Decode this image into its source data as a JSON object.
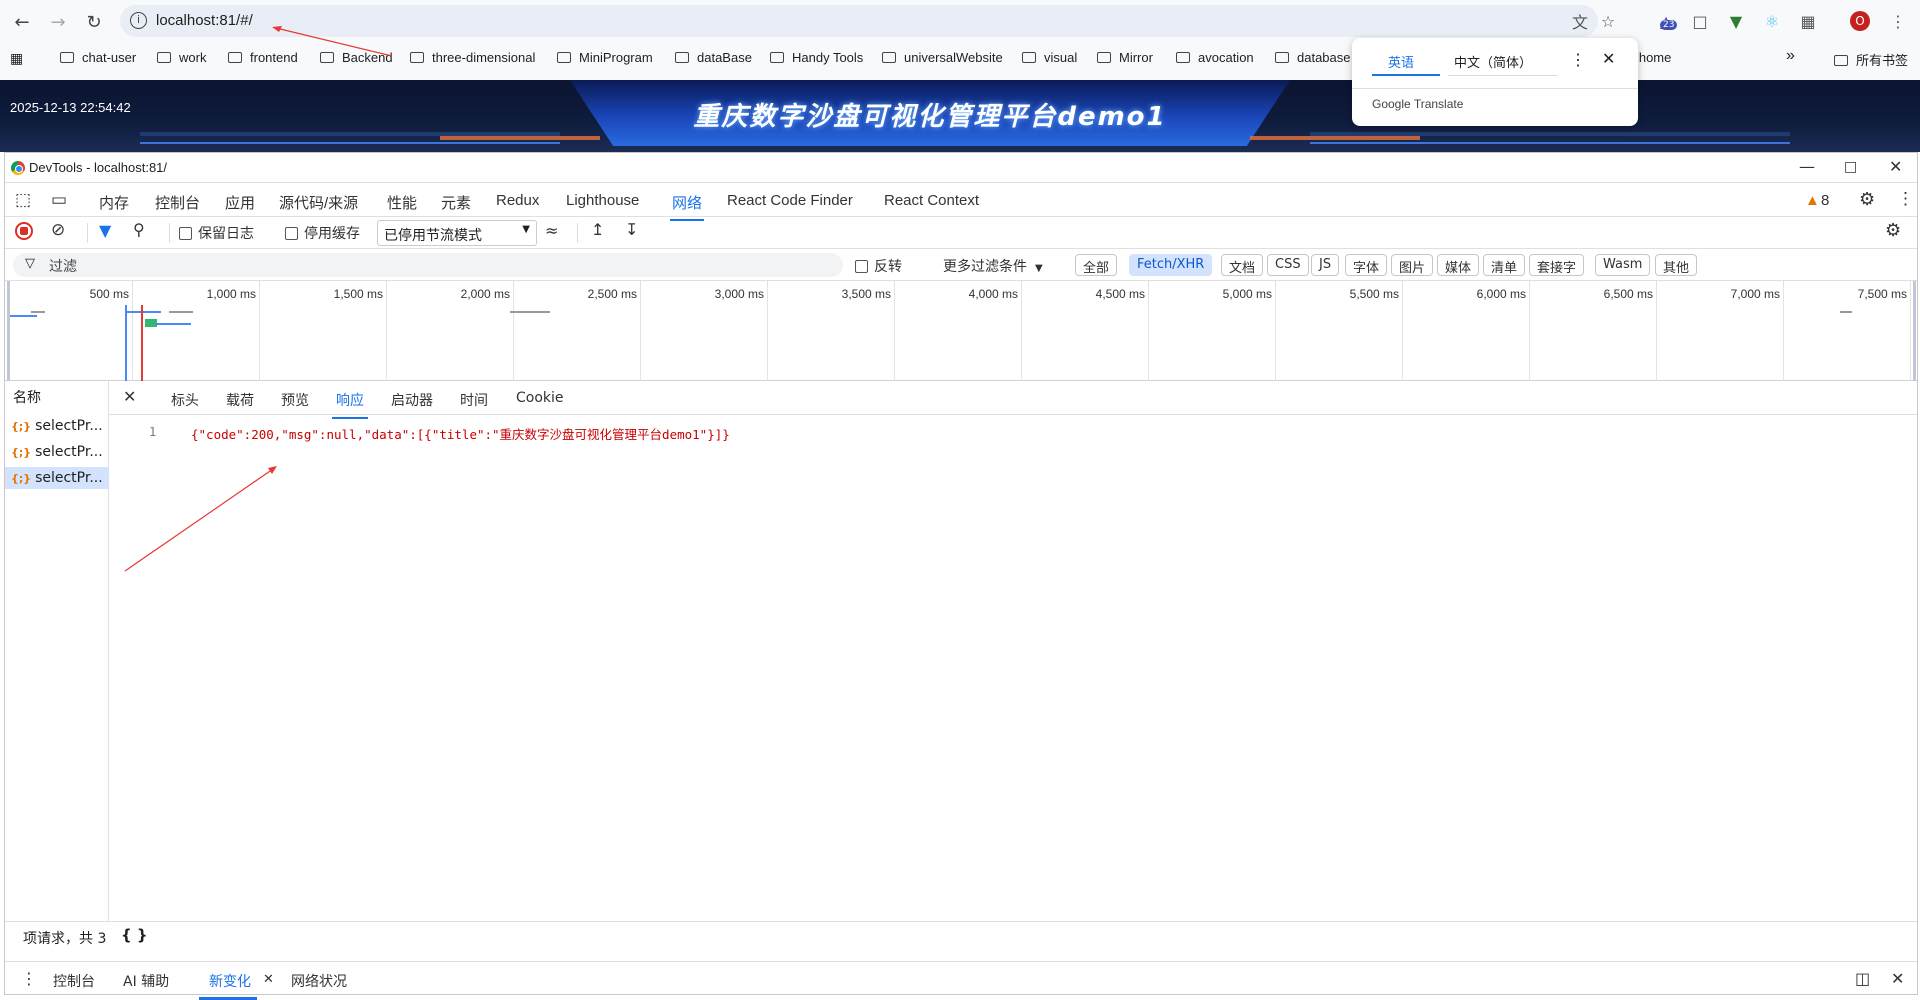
{
  "browser": {
    "url": "localhost:81/#/",
    "extension_badge": "23",
    "profile_initial": "O",
    "bookmarks": [
      "chat-user",
      "work",
      "frontend",
      "Backend",
      "three-dimensional",
      "MiniProgram",
      "dataBase",
      "Handy Tools",
      "universalWebsite",
      "visual",
      "Mirror",
      "avocation",
      "database"
    ],
    "bookmark_partial": "n home",
    "bookmarks_more": "»",
    "all_bookmarks": "所有书签"
  },
  "translate_popup": {
    "tab_english": "英语",
    "tab_chinese": "中文（简体）",
    "brand": "Google Translate"
  },
  "page": {
    "datetime": "2025-12-13 22:54:42",
    "title": "重庆数字沙盘可视化管理平台demo1"
  },
  "devtools": {
    "window_title": "DevTools - localhost:81/",
    "tabs": [
      "内存",
      "控制台",
      "应用",
      "源代码/来源",
      "性能",
      "元素",
      "Redux",
      "Lighthouse",
      "网络",
      "React Code Finder",
      "React Context"
    ],
    "active_tab": "网络",
    "warning_count": "8",
    "toolbar": {
      "preserve_log": "保留日志",
      "disable_cache": "停用缓存",
      "throttle": "已停用节流模式"
    },
    "filter": {
      "placeholder": "过滤",
      "invert": "反转",
      "more_filters": "更多过滤条件",
      "types": [
        "全部",
        "Fetch/XHR",
        "文档",
        "CSS",
        "JS",
        "字体",
        "图片",
        "媒体",
        "清单",
        "套接字",
        "Wasm",
        "其他"
      ],
      "selected_type": "Fetch/XHR"
    },
    "timeline_ticks": [
      "500 ms",
      "1,000 ms",
      "1,500 ms",
      "2,000 ms",
      "2,500 ms",
      "3,000 ms",
      "3,500 ms",
      "4,000 ms",
      "4,500 ms",
      "5,000 ms",
      "5,500 ms",
      "6,000 ms",
      "6,500 ms",
      "7,000 ms",
      "7,500 ms"
    ],
    "request_list": {
      "header": "名称",
      "items": [
        "selectPr...",
        "selectPr...",
        "selectPr..."
      ],
      "selected_index": 2
    },
    "detail_tabs": [
      "标头",
      "载荷",
      "预览",
      "响应",
      "启动器",
      "时间",
      "Cookie"
    ],
    "active_detail_tab": "响应",
    "response": {
      "line_number": "1",
      "body": "{\"code\":200,\"msg\":null,\"data\":[{\"title\":\"重庆数字沙盘可视化管理平台demo1\"}]}"
    },
    "status_text": "项请求，共 3",
    "format_button": "{ }",
    "drawer_tabs": [
      "控制台",
      "AI 辅助",
      "新变化",
      "网络状况"
    ],
    "active_drawer_tab": "新变化"
  },
  "colors": {
    "accent": "#1a73e8",
    "annotation_arrow": "#e53935",
    "banner_blue": "#1a45b8"
  }
}
